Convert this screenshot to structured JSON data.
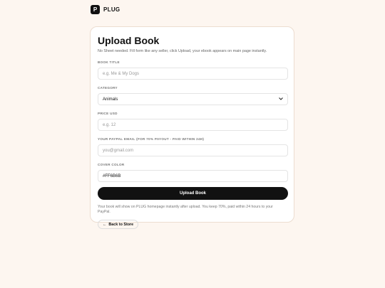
{
  "brand": {
    "logo_letter": "P",
    "name": "PLUG"
  },
  "form": {
    "title": "Upload Book",
    "subtitle": "No Sheet needed. Fill form like any seller, click Upload, your ebook appears on main page instantly.",
    "fields": {
      "book_title": {
        "label": "Book title",
        "placeholder": "e.g. Me & My Dogs"
      },
      "category": {
        "label": "Category",
        "value": "Animals"
      },
      "price": {
        "label": "Price USD",
        "placeholder": "e.g. 12"
      },
      "paypal_email": {
        "label": "Your PayPal email (for 70% payout - paid within 24h)",
        "placeholder": "you@gmail.com"
      },
      "cover_color": {
        "label": "Cover color",
        "value": "#FF6B6B"
      }
    },
    "upload_button": "Upload Book",
    "note": "Your book will show on PLUG homepage instantly after upload. You keep 70%, paid within 24 hours to your PayPal.",
    "back_button": "Back to Store",
    "back_arrow": "←"
  },
  "icons": {
    "select_chevron": "chevron-down-icon",
    "back": "arrow-left-icon"
  },
  "colors": {
    "page_bg": "#fdf6f0",
    "primary": "#111111",
    "card_bg": "#ffffff"
  }
}
